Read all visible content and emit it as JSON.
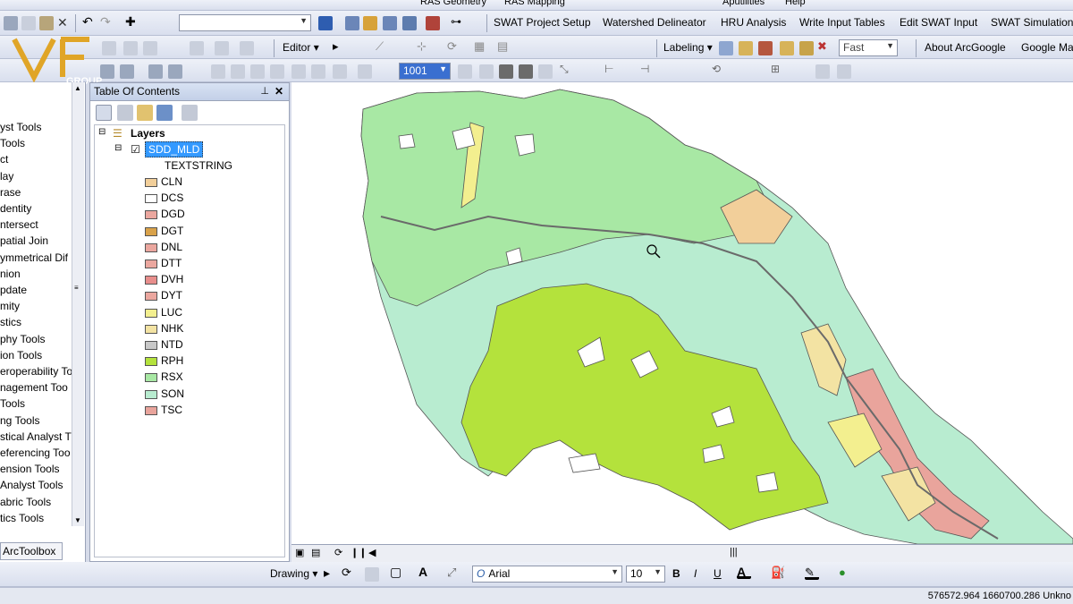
{
  "menubar": {
    "items": [
      "RAS Geometry",
      "RAS Mapping",
      "Aputilities",
      "Help"
    ]
  },
  "toolbar1": {
    "swat_menus": [
      "SWAT Project Setup",
      "Watershed Delineator",
      "HRU Analysis",
      "Write Input Tables",
      "Edit SWAT Input",
      "SWAT Simulation"
    ]
  },
  "toolbar2": {
    "editor_label": "Editor",
    "labeling_label": "Labeling",
    "quality_value": "Fast",
    "about_label": "About ArcGoogle",
    "google_label": "Google Ma"
  },
  "toolbar3": {
    "combo_value": "1001"
  },
  "toolbox": {
    "items": [
      "yst Tools",
      "Tools",
      "ct",
      "lay",
      "rase",
      "dentity",
      "ntersect",
      "patial Join",
      "ymmetrical Dif",
      "nion",
      "pdate",
      "mity",
      "stics",
      "phy Tools",
      "ion Tools",
      "eroperability To",
      "nagement Too",
      "Tools",
      "ng Tools",
      "stical Analyst T",
      "eferencing Too",
      "ension Tools",
      "Analyst Tools",
      "abric Tools",
      "tics Tools"
    ],
    "tab_label": "ArcToolbox"
  },
  "toc": {
    "title": "Table Of Contents",
    "pin": "⊥",
    "close": "✕",
    "layers_label": "Layers",
    "layer_name": "SDD_MLD",
    "field_name": "TEXTSTRING",
    "classes": [
      {
        "code": "CLN",
        "color": "#f2cf9a"
      },
      {
        "code": "DCS",
        "color": "#ffffff"
      },
      {
        "code": "DGD",
        "color": "#eba79f"
      },
      {
        "code": "DGT",
        "color": "#d9a24a"
      },
      {
        "code": "DNL",
        "color": "#eba79f"
      },
      {
        "code": "DTT",
        "color": "#eba79f"
      },
      {
        "code": "DVH",
        "color": "#e88e8c"
      },
      {
        "code": "DYT",
        "color": "#eba79f"
      },
      {
        "code": "LUC",
        "color": "#f3ef8f"
      },
      {
        "code": "NHK",
        "color": "#f3e3a3"
      },
      {
        "code": "NTD",
        "color": "#c8c8c8"
      },
      {
        "code": "RPH",
        "color": "#b4e23c"
      },
      {
        "code": "RSX",
        "color": "#a8e8a4"
      },
      {
        "code": "SON",
        "color": "#b8ecd0"
      },
      {
        "code": "TSC",
        "color": "#e9a49c"
      }
    ]
  },
  "drawbar": {
    "drawing_label": "Drawing",
    "font_name": "Arial",
    "font_size": "10",
    "bold": "B",
    "italic": "I",
    "underline": "U"
  },
  "status": {
    "coords": "576572.964  1660700.286 Unkno"
  },
  "watermark": {
    "text": "VF",
    "subtext": "GROUP"
  },
  "colors": {
    "rph": "#b4e23c",
    "rsx": "#a8e8a4",
    "son": "#b8ecd0",
    "tsc": "#e9a49c",
    "cln": "#f2cf9a",
    "nhk": "#f3e3a3",
    "luc": "#f3ef8f",
    "selection": "#3399ff"
  }
}
